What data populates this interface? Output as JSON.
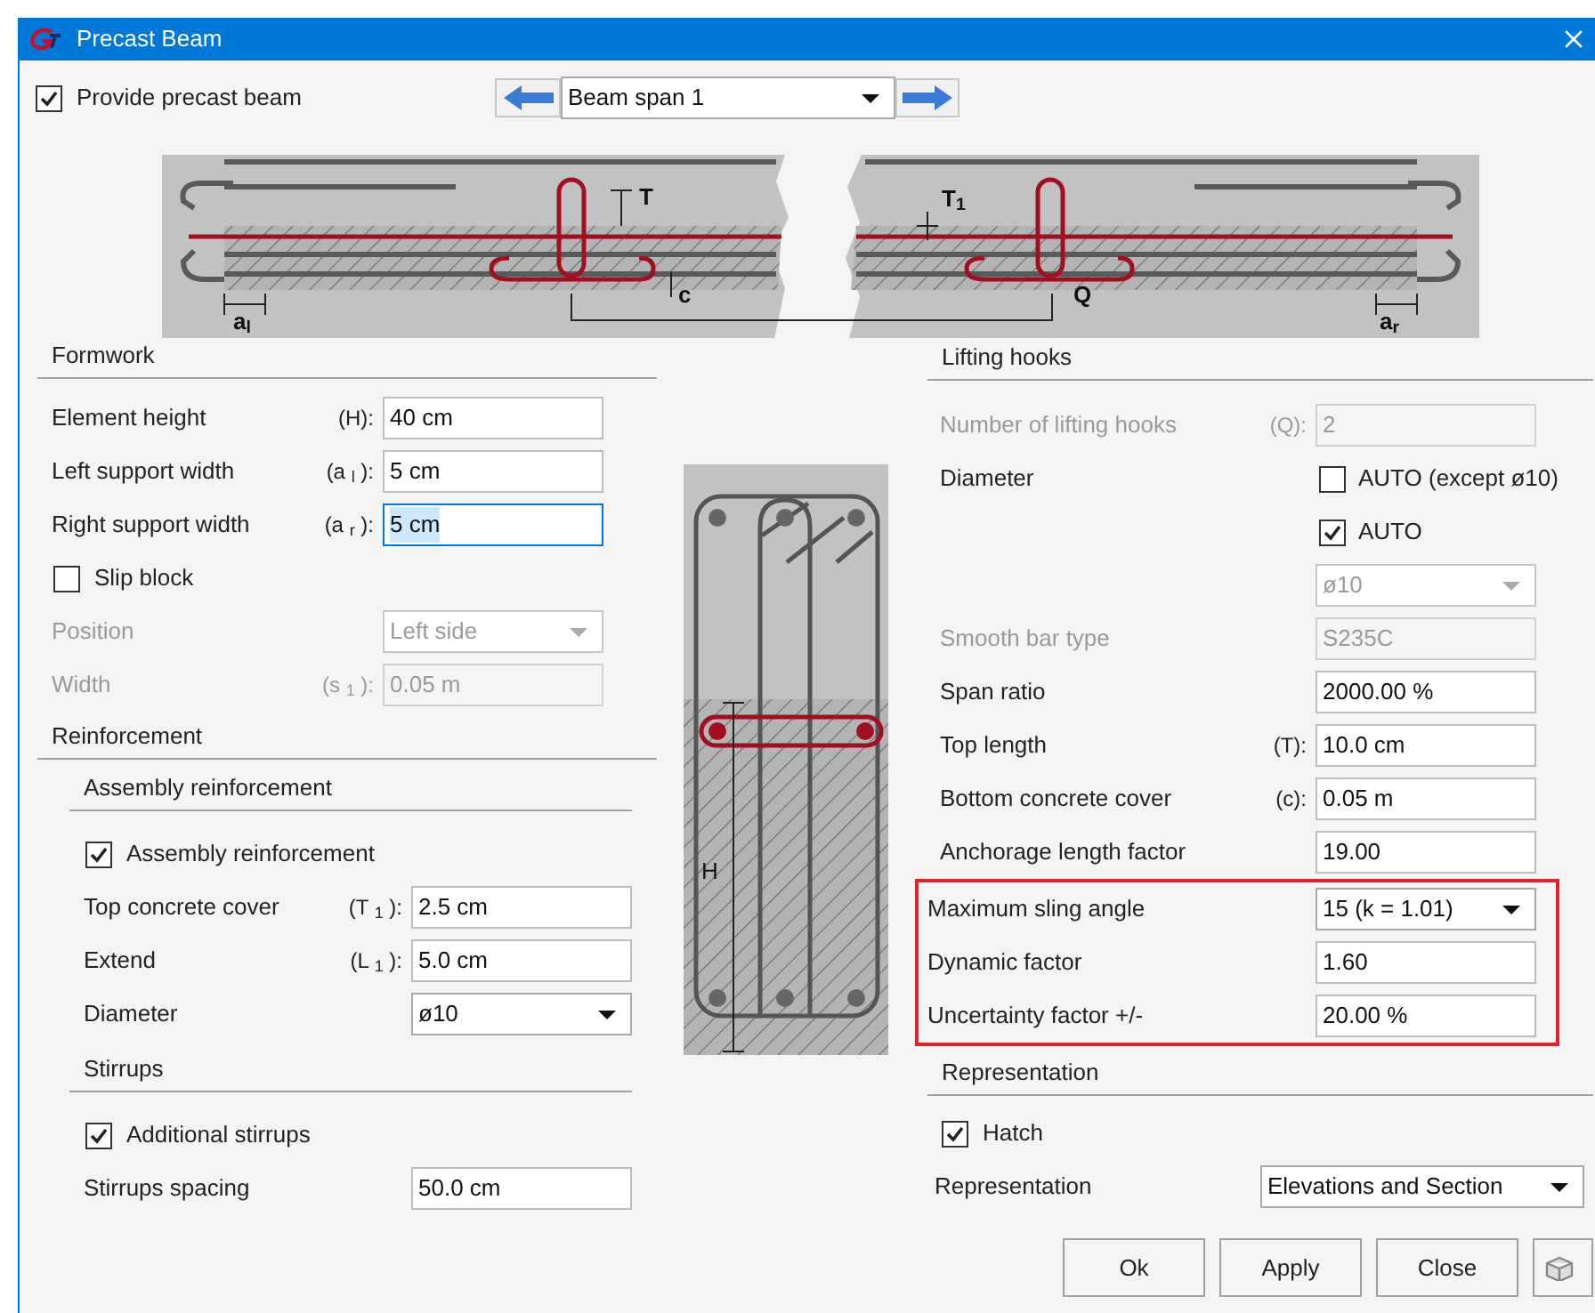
{
  "window": {
    "title": "Precast Beam"
  },
  "provide_precast_beam": {
    "label": "Provide precast beam",
    "checked": true
  },
  "span_navigator": {
    "value": "Beam span 1"
  },
  "beam_drawing": {
    "labels": [
      "T",
      "T$_{1}$",
      "c",
      "Q",
      "a$_{l}$",
      "a$_{r}$"
    ]
  },
  "formwork": {
    "title": "Formwork",
    "rows": [
      {
        "kind": "input",
        "label": "Element height",
        "code": "(H):",
        "value": "40 cm",
        "disabled": false,
        "focused": false
      },
      {
        "kind": "input",
        "label": "Left support width",
        "code": "(a $_{l}$ ):",
        "value": "5 cm",
        "disabled": false,
        "focused": false
      },
      {
        "kind": "input",
        "label": "Right support width",
        "code": "(a $_{r}$ ):",
        "value": "5 cm",
        "disabled": false,
        "focused": true
      },
      {
        "kind": "checkbox",
        "label": "Slip block",
        "checked": false
      },
      {
        "kind": "select",
        "label": "Position",
        "value": "Left side",
        "disabled": true
      },
      {
        "kind": "input",
        "label": "Width",
        "code": "(s $_{1}$ ):",
        "value": "0.05 m",
        "disabled": true,
        "focused": false
      }
    ]
  },
  "reinforcement": {
    "title": "Reinforcement",
    "groups": [
      {
        "title": "Assembly reinforcement",
        "rows": [
          {
            "kind": "checkbox",
            "label": "Assembly reinforcement",
            "checked": true
          },
          {
            "kind": "input",
            "label": "Top concrete cover",
            "code": "(T $_{1}$ ):",
            "value": "2.5 cm",
            "disabled": false,
            "focused": false
          },
          {
            "kind": "input",
            "label": "Extend",
            "code": "(L $_{1}$ ):",
            "value": "5.0 cm",
            "disabled": false,
            "focused": false
          },
          {
            "kind": "select",
            "label": "Diameter",
            "value": "ø10",
            "disabled": false
          }
        ]
      },
      {
        "title": "Stirrups",
        "rows": [
          {
            "kind": "checkbox",
            "label": "Additional stirrups",
            "checked": true
          },
          {
            "kind": "input",
            "label": "Stirrups spacing",
            "value": "50.0 cm",
            "disabled": false,
            "focused": false
          }
        ]
      }
    ]
  },
  "section_drawing": {
    "label": "H"
  },
  "lifting_hooks": {
    "title": "Lifting hooks",
    "rows": [
      {
        "kind": "input",
        "label": "Number of lifting hooks",
        "code": "(Q):",
        "value": "2",
        "disabled": true,
        "focused": false,
        "highlighted": false
      },
      {
        "kind": "label_checkbox",
        "label": "Diameter",
        "checkbox_label": "AUTO (except ø10)",
        "checked": false,
        "highlighted": false
      },
      {
        "kind": "control_checkbox",
        "checkbox_label": "AUTO",
        "checked": true,
        "highlighted": false
      },
      {
        "kind": "select",
        "value": "ø10",
        "disabled": true,
        "highlighted": false
      },
      {
        "kind": "input",
        "label": "Smooth bar type",
        "value": "S235C",
        "disabled": true,
        "focused": false,
        "highlighted": false
      },
      {
        "kind": "input",
        "label": "Span ratio",
        "value": "2000.00 %",
        "disabled": false,
        "focused": false,
        "highlighted": false
      },
      {
        "kind": "input",
        "label": "Top length",
        "code": "(T):",
        "value": "10.0 cm",
        "disabled": false,
        "focused": false,
        "highlighted": false
      },
      {
        "kind": "input",
        "label": "Bottom concrete cover",
        "code": "(c):",
        "value": "0.05 m",
        "disabled": false,
        "focused": false,
        "highlighted": false
      },
      {
        "kind": "input",
        "label": "Anchorage length factor",
        "value": "19.00",
        "disabled": false,
        "focused": false,
        "highlighted": false
      },
      {
        "kind": "select",
        "label": "Maximum sling angle",
        "value": "15 (k = 1.01)",
        "disabled": false,
        "highlighted": true
      },
      {
        "kind": "input",
        "label": "Dynamic factor",
        "value": "1.60",
        "disabled": false,
        "focused": false,
        "highlighted": true
      },
      {
        "kind": "input",
        "label": "Uncertainty factor +/-",
        "value": "20.00 %",
        "disabled": false,
        "focused": false,
        "highlighted": true
      }
    ]
  },
  "representation": {
    "title": "Representation",
    "hatch": {
      "label": "Hatch",
      "checked": true
    },
    "select": {
      "label": "Representation",
      "value": "Elevations and Section"
    }
  },
  "buttons": [
    {
      "label": "Ok"
    },
    {
      "label": "Apply"
    },
    {
      "label": "Close"
    }
  ]
}
